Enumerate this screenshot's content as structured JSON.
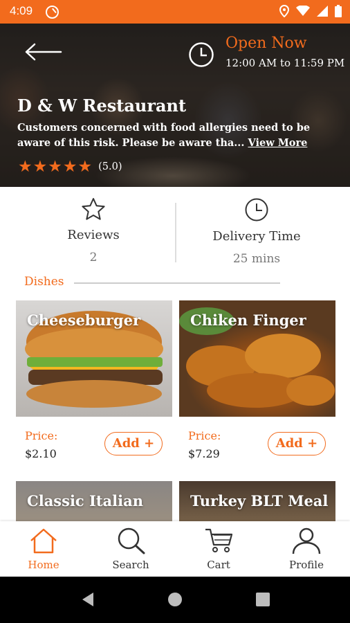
{
  "status_bar": {
    "time": "4:09"
  },
  "hero": {
    "open_status": "Open Now",
    "hours": "12:00 AM to 11:59 PM",
    "restaurant_name": "D & W Restaurant",
    "description": "Customers concerned with food allergies need to be aware of this risk. Please be aware tha...",
    "view_more": "View More",
    "rating": "(5.0)",
    "stars": 5
  },
  "stats": {
    "reviews_label": "Reviews",
    "reviews_value": "2",
    "delivery_label": "Delivery Time",
    "delivery_value": "25 mins"
  },
  "dishes": {
    "title": "Dishes",
    "items": [
      {
        "name": "Cheeseburger",
        "price_label": "Price:",
        "price": "$2.10",
        "add_label": "Add +"
      },
      {
        "name": "Chiken Finger",
        "price_label": "Price:",
        "price": "$7.29",
        "add_label": "Add +"
      },
      {
        "name": "Classic Italian"
      },
      {
        "name": "Turkey BLT  Meal"
      }
    ]
  },
  "bottom_nav": {
    "items": [
      {
        "label": "Home",
        "icon": "home-icon",
        "active": true
      },
      {
        "label": "Search",
        "icon": "search-icon"
      },
      {
        "label": "Cart",
        "icon": "cart-icon"
      },
      {
        "label": "Profile",
        "icon": "profile-icon"
      }
    ]
  },
  "colors": {
    "accent": "#f26b1d"
  }
}
